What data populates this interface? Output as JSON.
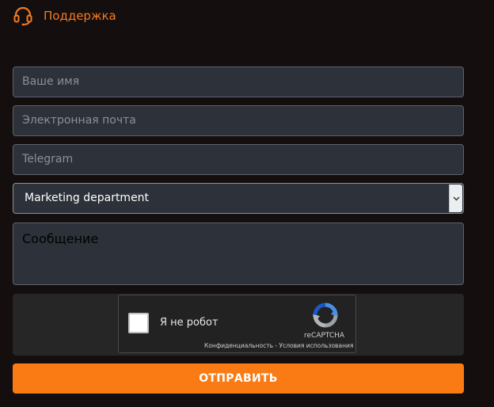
{
  "header": {
    "title": "Поддержка",
    "icon": "headset-icon",
    "accent_color": "#f47a20"
  },
  "form": {
    "name_placeholder": "Ваше имя",
    "email_placeholder": "Электронная почта",
    "telegram_placeholder": "Telegram",
    "department_selected": "Marketing department",
    "message_placeholder": "Сообщение",
    "submit_label": "ОТПРАВИТЬ",
    "submit_color": "#fa7a13"
  },
  "captcha": {
    "label": "Я не робот",
    "brand": "reCAPTCHA",
    "privacy": "Конфиденциальность",
    "separator": " - ",
    "terms": "Условия использования",
    "checked": false
  }
}
